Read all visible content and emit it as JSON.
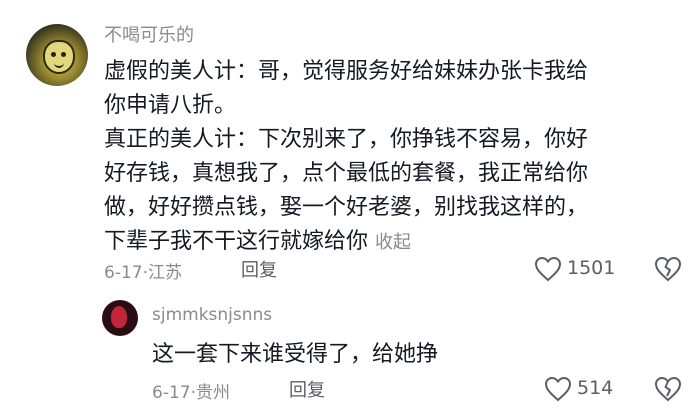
{
  "comment1": {
    "username": "不喝可乐的",
    "lines": [
      "虚假的美人计：哥，觉得服务好给妹妹办张卡我给",
      "你申请八折。",
      "真正的美人计：下次别来了，你挣钱不容易，你好",
      "好存钱，真想我了，点个最低的套餐，我正常给你",
      "做，好好攒点钱，娶一个好老婆，别找我这样的，",
      "下辈子我不干这行就嫁给你"
    ],
    "collapse_label": "收起",
    "date": "6-17",
    "separator": "·",
    "location": "江苏",
    "reply_label": "回复",
    "like_count": "1501",
    "like_icon": "heart-outline",
    "dislike_icon": "broken-heart"
  },
  "comment2": {
    "username": "sjmmksnjsnns",
    "text": "这一套下来谁受得了，给她挣",
    "date": "6-17",
    "separator": "·",
    "location": "贵州",
    "reply_label": "回复",
    "like_count": "514",
    "like_icon": "heart-outline",
    "dislike_icon": "broken-heart"
  }
}
